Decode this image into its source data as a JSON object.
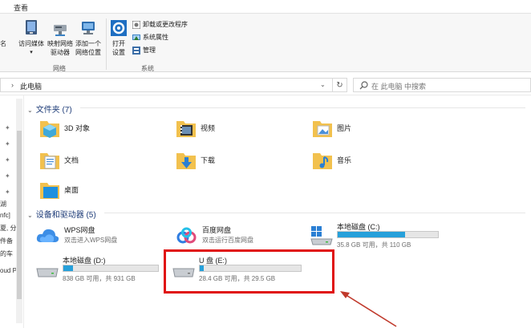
{
  "ribbon": {
    "tab_view": "查看",
    "left_stub": "名",
    "access_media": "访问媒体",
    "map_drive": [
      "映射网络",
      "驱动器"
    ],
    "add_location": [
      "添加一个",
      "网络位置"
    ],
    "group_network": "网络",
    "open_settings": [
      "打开",
      "设置"
    ],
    "uninstall": "卸载或更改程序",
    "sys_props": "系统属性",
    "manage": "管理",
    "group_system": "系统"
  },
  "address": {
    "path": "此电脑",
    "search_placeholder": "在 此电脑 中搜索"
  },
  "nav": {
    "snippets": [
      "湖",
      "nfc]",
      "夏, 分",
      "件备",
      "的车",
      "oud P"
    ]
  },
  "folders_section": {
    "title": "文件夹 (7)",
    "items": [
      {
        "name": "3D 对象",
        "icon": "3d-objects-folder-icon"
      },
      {
        "name": "视频",
        "icon": "videos-folder-icon"
      },
      {
        "name": "图片",
        "icon": "pictures-folder-icon"
      },
      {
        "name": "文档",
        "icon": "documents-folder-icon"
      },
      {
        "name": "下载",
        "icon": "downloads-folder-icon"
      },
      {
        "name": "音乐",
        "icon": "music-folder-icon"
      },
      {
        "name": "桌面",
        "icon": "desktop-folder-icon"
      }
    ]
  },
  "devices_section": {
    "title": "设备和驱动器 (5)",
    "wps": {
      "name": "WPS网盘",
      "desc": "双击进入WPS网盘"
    },
    "baidu": {
      "name": "百度网盘",
      "desc": "双击运行百度网盘"
    },
    "drive_c": {
      "name": "本地磁盘 (C:)",
      "info": "35.8 GB 可用，共 110 GB",
      "used_fraction": 0.67
    },
    "drive_d": {
      "name": "本地磁盘 (D:)",
      "info": "838 GB 可用，共 931 GB",
      "used_fraction": 0.1
    },
    "drive_e": {
      "name": "U 盘 (E:)",
      "info": "28.4 GB 可用，共 29.5 GB",
      "used_fraction": 0.04
    }
  },
  "colors": {
    "highlight_border": "#e01010",
    "drive_fill": "#26a0da",
    "folder_yellow": "#f2c14e"
  }
}
